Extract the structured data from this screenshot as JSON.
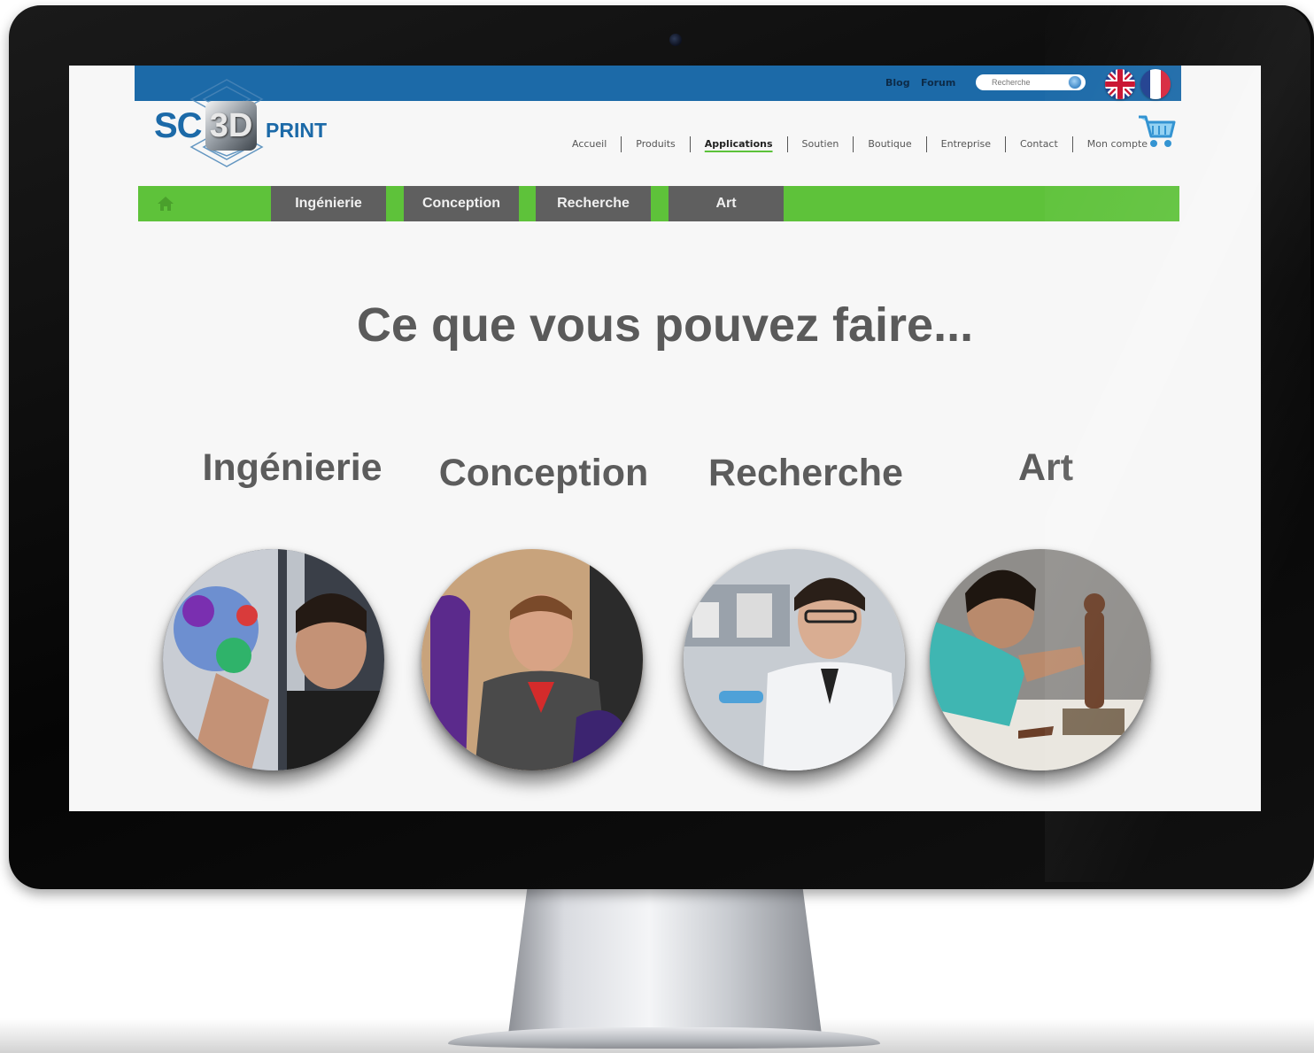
{
  "topbar": {
    "blog_label": "Blog",
    "forum_label": "Forum",
    "search_placeholder": "Recherche"
  },
  "logo": {
    "left_text": "SC",
    "middle_text": "3D",
    "right_text": "PRINT"
  },
  "main_nav": {
    "items": [
      {
        "label": "Accueil"
      },
      {
        "label": "Produits"
      },
      {
        "label": "Applications",
        "active": true
      },
      {
        "label": "Soutien"
      },
      {
        "label": "Boutique"
      },
      {
        "label": "Entreprise"
      },
      {
        "label": "Contact"
      },
      {
        "label": "Mon compte"
      }
    ]
  },
  "sub_nav": {
    "tabs": [
      {
        "label": "Ingénierie"
      },
      {
        "label": "Conception"
      },
      {
        "label": "Recherche"
      },
      {
        "label": "Art"
      }
    ]
  },
  "main": {
    "headline": "Ce que vous pouvez faire...",
    "categories": [
      {
        "label": "Ingénierie"
      },
      {
        "label": "Conception"
      },
      {
        "label": "Recherche"
      },
      {
        "label": "Art"
      }
    ]
  },
  "colors": {
    "brand_blue": "#1c6aa8",
    "accent_green": "#5ec23a",
    "tab_gray": "#5f5f5f",
    "text_gray": "#5a5a5a"
  },
  "icons": {
    "search": "search-icon",
    "cart": "cart-icon",
    "home": "home-icon",
    "flag_en": "uk-flag-icon",
    "flag_fr": "france-flag-icon"
  }
}
